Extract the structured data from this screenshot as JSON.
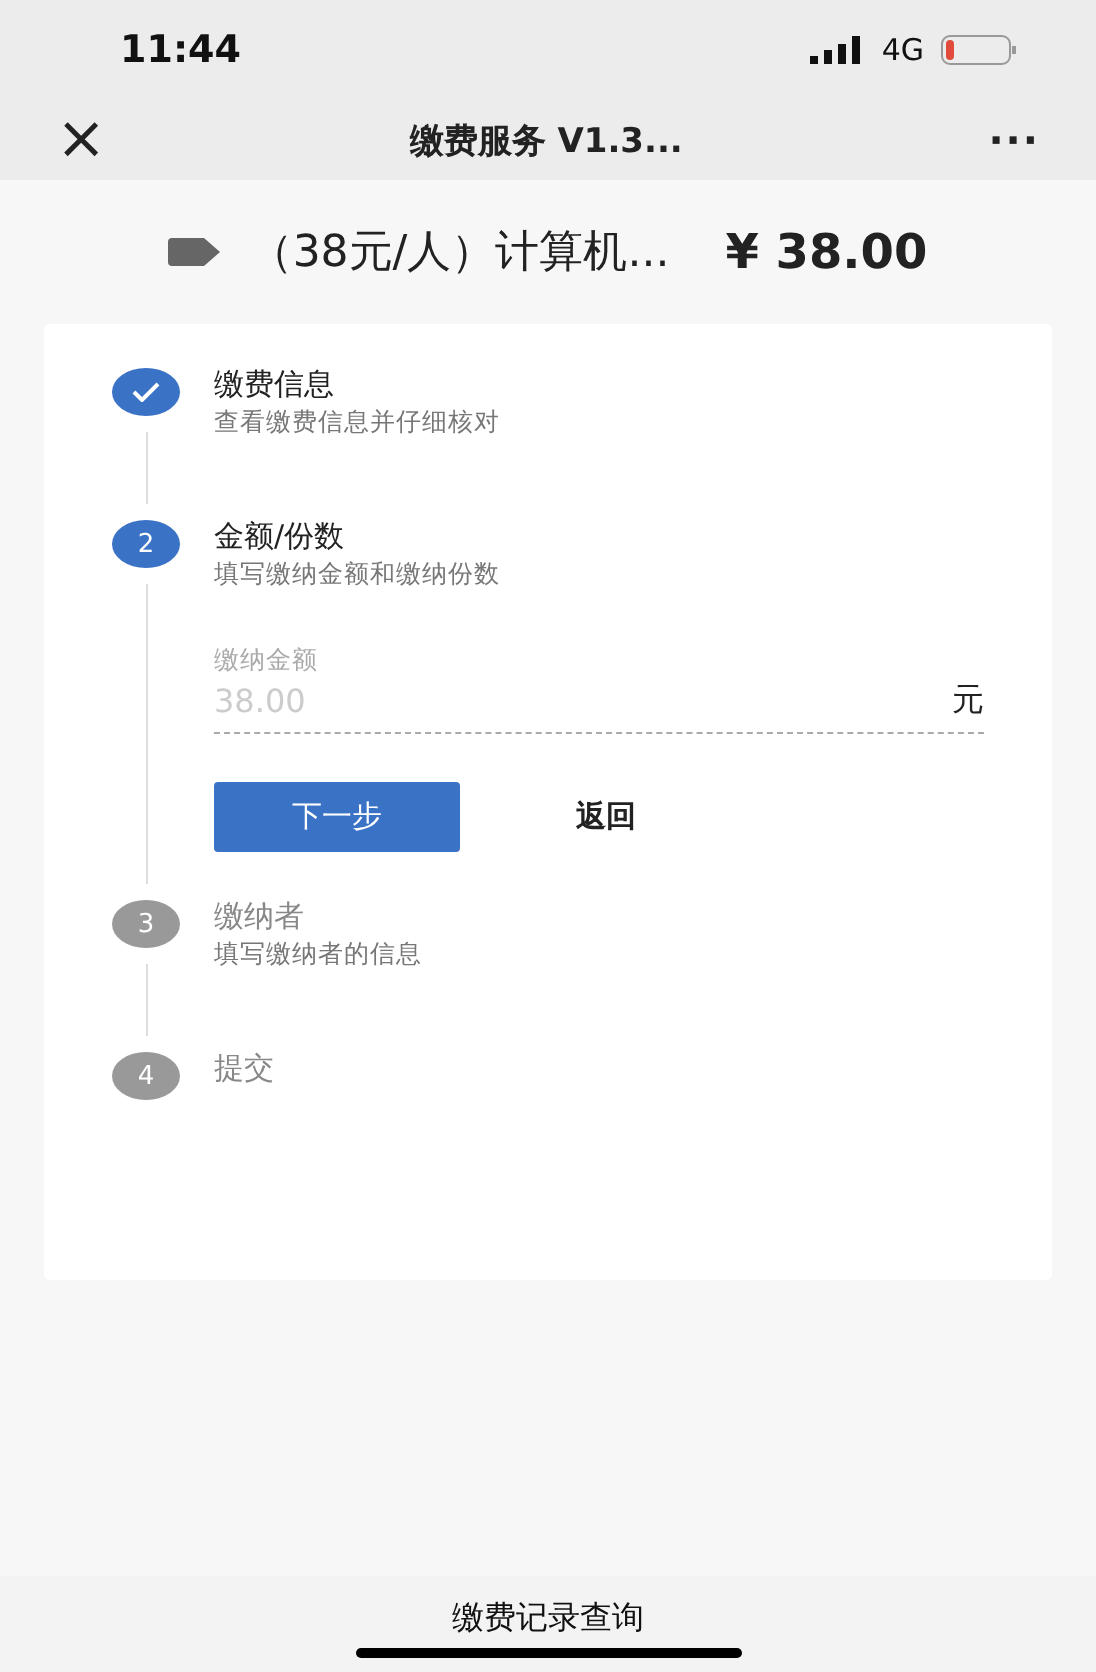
{
  "status_bar": {
    "time": "11:44",
    "network": "4G"
  },
  "nav": {
    "close": "×",
    "title": "缴费服务 V1.3...",
    "more": "···"
  },
  "product": {
    "name": "（38元/人）计算机...",
    "price": "¥ 38.00"
  },
  "steps": [
    {
      "kind": "done",
      "title": "缴费信息",
      "subtitle": "查看缴费信息并仔细核对"
    },
    {
      "kind": "active",
      "number": "2",
      "title": "金额/份数",
      "subtitle": "填写缴纳金额和缴纳份数",
      "field": {
        "label": "缴纳金额",
        "placeholder": "38.00",
        "unit": "元"
      },
      "buttons": [
        {
          "kind": "primary",
          "label": "下一步"
        },
        {
          "kind": "text",
          "label": "返回"
        }
      ]
    },
    {
      "kind": "pending",
      "number": "3",
      "title": "缴纳者",
      "subtitle": "填写缴纳者的信息"
    },
    {
      "kind": "pending",
      "number": "4",
      "title": "提交"
    }
  ],
  "footer": {
    "label": "缴费记录查询"
  }
}
